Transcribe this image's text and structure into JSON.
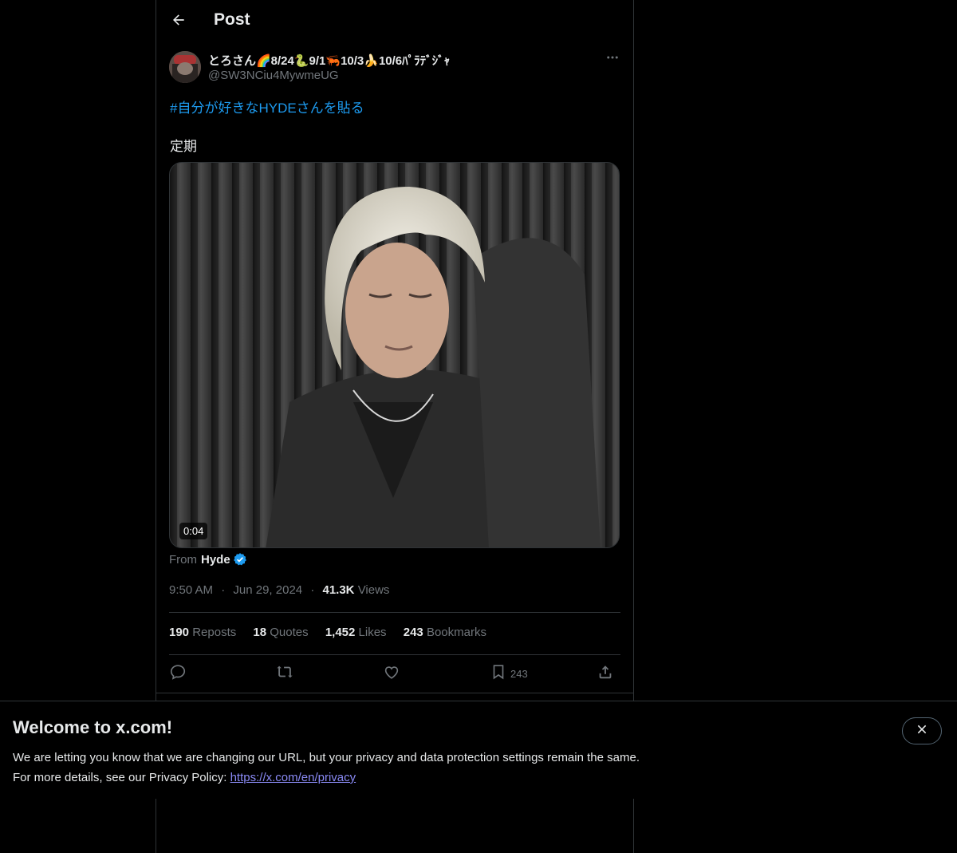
{
  "header": {
    "title": "Post",
    "back_icon": "arrow-left-icon"
  },
  "post": {
    "author": {
      "display_name": "とろさん🌈8/24🐍9/1🦐10/3🍌10/6ﾊﾟﾗﾃﾞｼﾞｬ",
      "handle": "@SW3NCiu4MywmeUG"
    },
    "text": {
      "hashtag": "#自分が好きなHYDEさんを貼る",
      "line2": "定期"
    },
    "media": {
      "duration": "0:04"
    },
    "source": {
      "prefix": "From",
      "name": "Hyde",
      "verified": true
    },
    "meta": {
      "time": "9:50 AM",
      "separator": "·",
      "date": "Jun 29, 2024",
      "views_count": "41.3K",
      "views_label": "Views"
    },
    "stats": {
      "reposts": {
        "count": "190",
        "label": "Reposts"
      },
      "quotes": {
        "count": "18",
        "label": "Quotes"
      },
      "likes": {
        "count": "1,452",
        "label": "Likes"
      },
      "bookmarks": {
        "count": "243",
        "label": "Bookmarks"
      }
    },
    "actions": {
      "bookmark_count": "243"
    }
  },
  "banner": {
    "title": "Welcome to x.com!",
    "line1": "We are letting you know that we are changing our URL, but your privacy and data protection settings remain the same.",
    "line2_prefix": "For more details, see our Privacy Policy: ",
    "link": "https://x.com/en/privacy"
  },
  "colors": {
    "accent": "#1d9bf0",
    "background": "#000000",
    "text": "#e7e9ea",
    "muted": "#71767b",
    "border": "#2f3336"
  }
}
